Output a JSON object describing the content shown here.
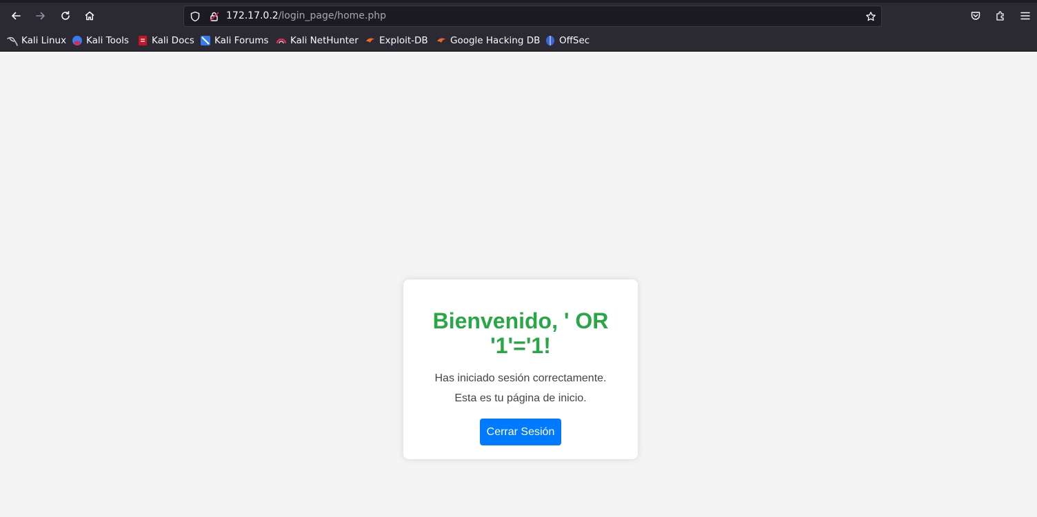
{
  "browser": {
    "url": {
      "host": "172.17.0.2",
      "path": "/login_page/home.php"
    },
    "bookmarks": [
      {
        "label": "Kali Linux",
        "icon": "kali-dragon-icon"
      },
      {
        "label": "Kali Tools",
        "icon": "kali-tools-icon"
      },
      {
        "label": "Kali Docs",
        "icon": "kali-docs-icon"
      },
      {
        "label": "Kali Forums",
        "icon": "kali-forums-icon"
      },
      {
        "label": "Kali NetHunter",
        "icon": "kali-nethunter-icon"
      },
      {
        "label": "Exploit-DB",
        "icon": "exploit-db-icon"
      },
      {
        "label": "Google Hacking DB",
        "icon": "ghdb-icon"
      },
      {
        "label": "OffSec",
        "icon": "offsec-icon"
      }
    ]
  },
  "page": {
    "welcome_title": "Bienvenido, ' OR '1'='1!",
    "line1": "Has iniciado sesión correctamente.",
    "line2": "Esta es tu página de inicio.",
    "logout_label": "Cerrar Sesión"
  },
  "colors": {
    "title_green": "#28a745",
    "button_blue": "#007bff",
    "page_bg": "#f4f4f4",
    "toolbar_bg": "#2b2a33"
  }
}
